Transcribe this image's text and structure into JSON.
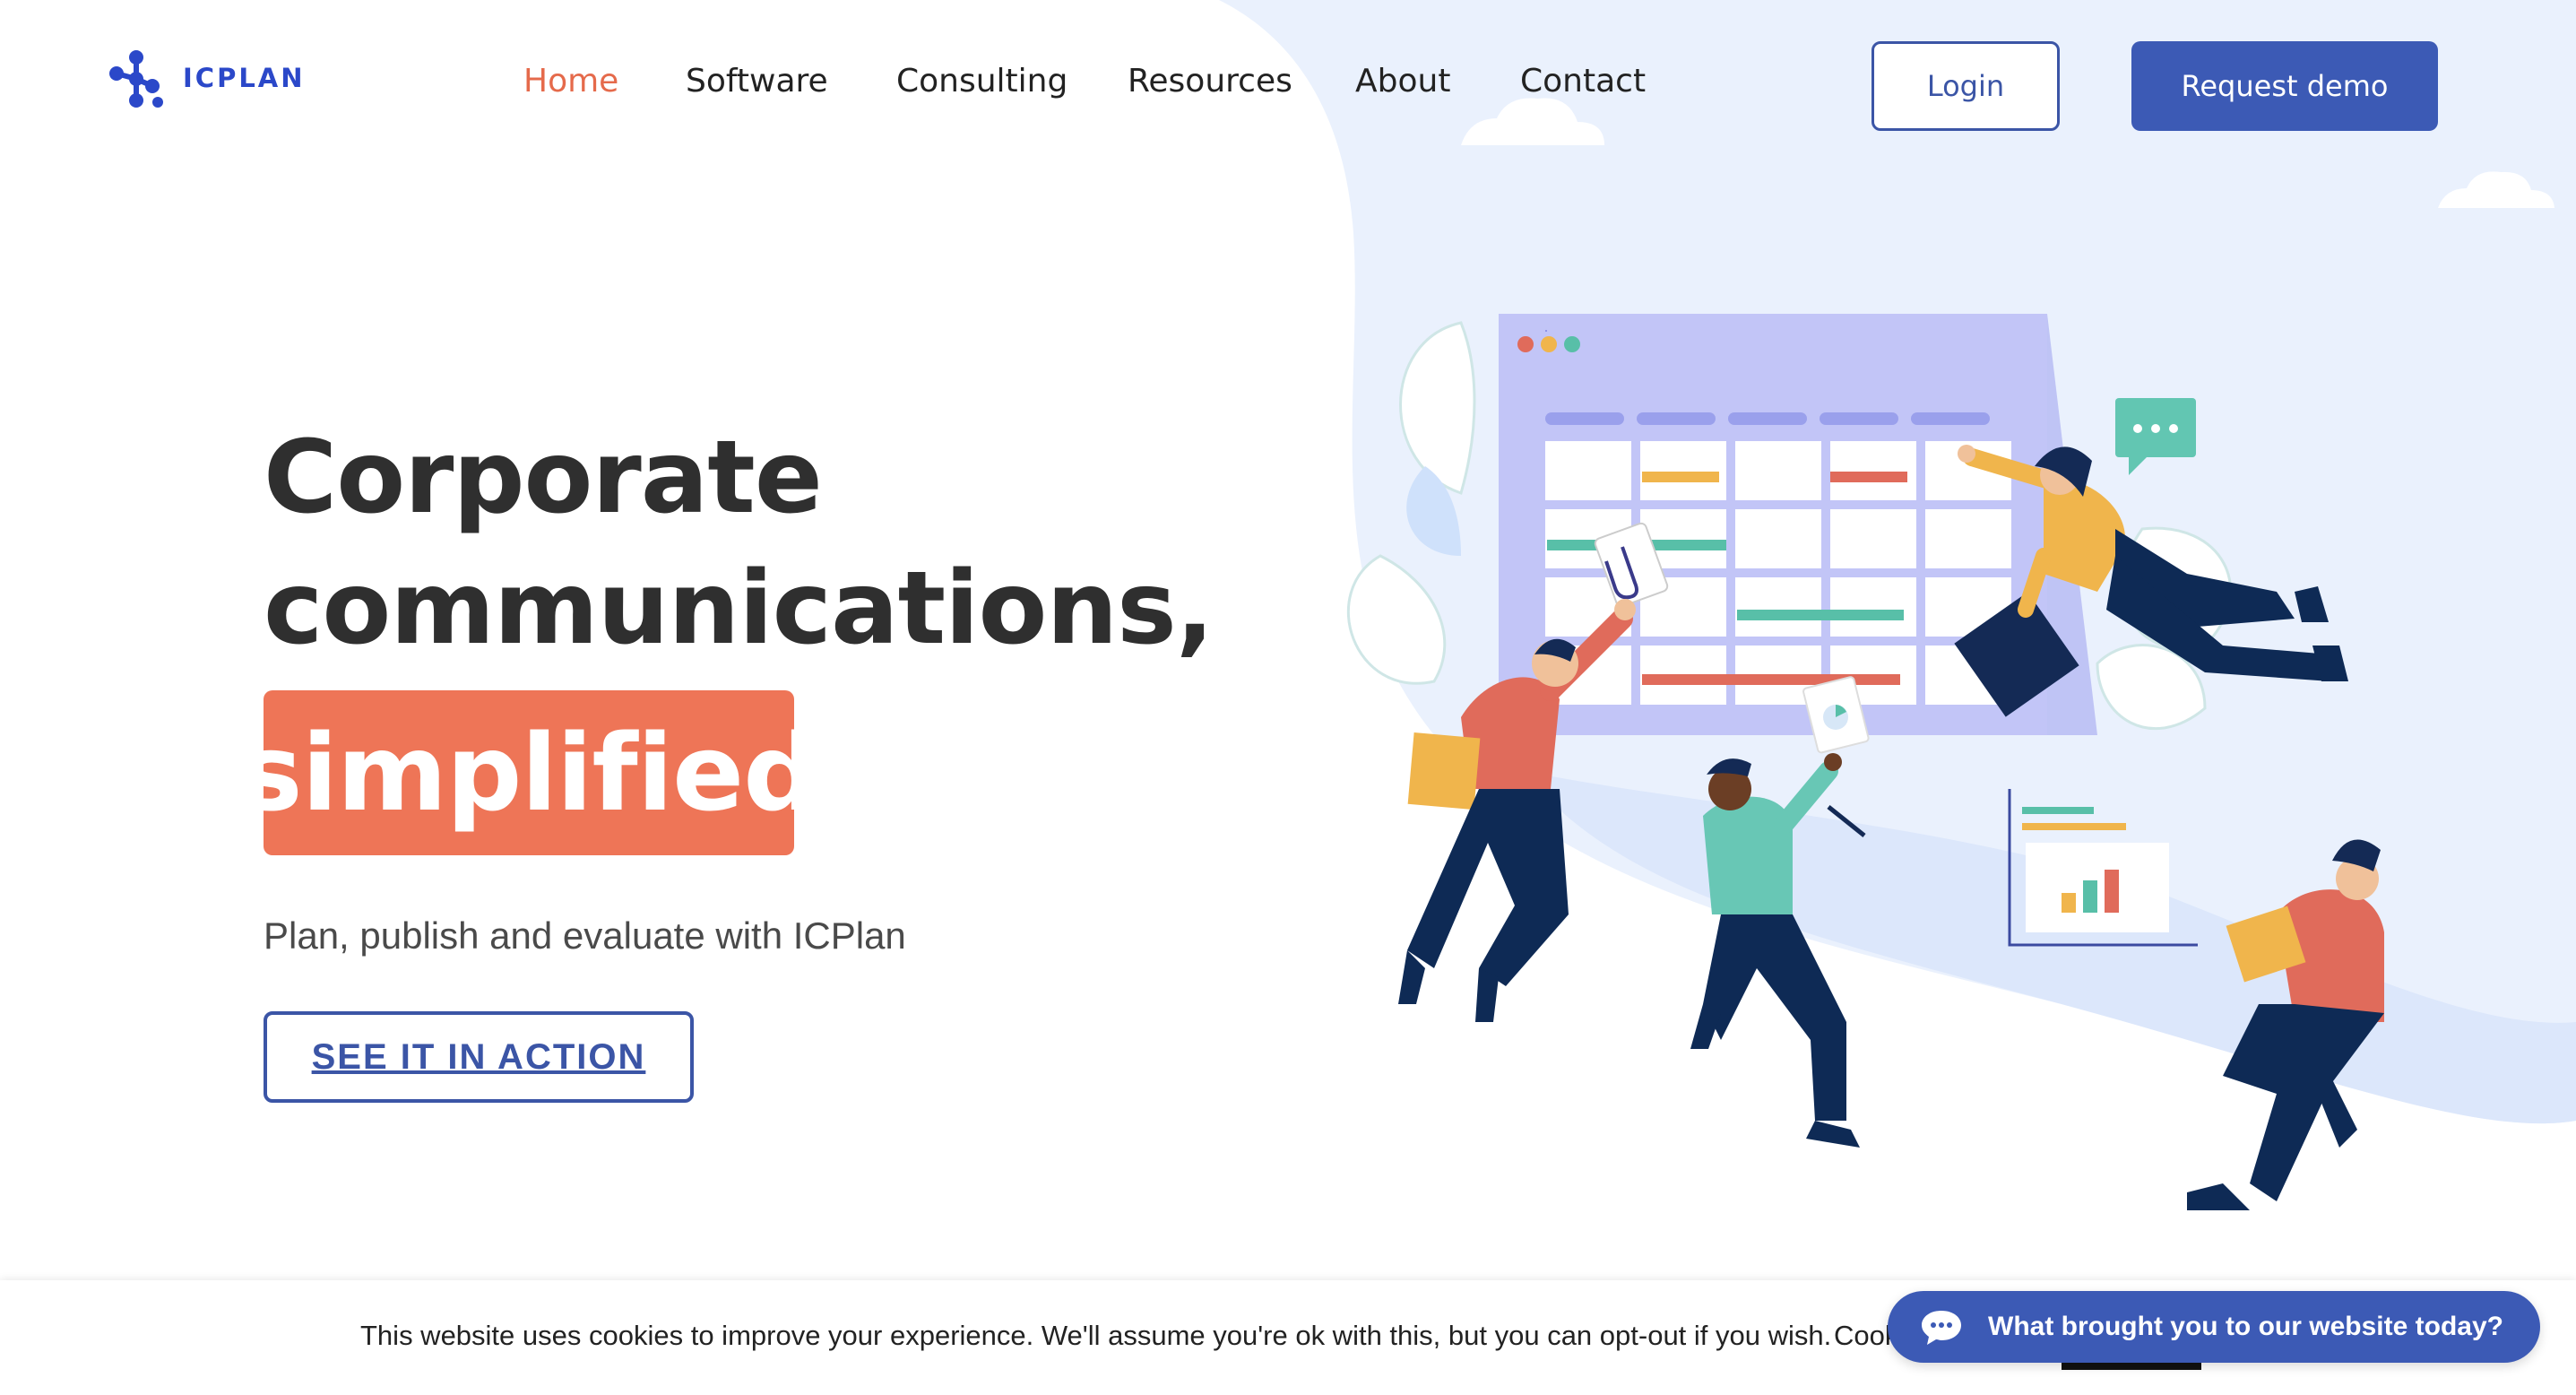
{
  "brand": {
    "name": "ICPLAN",
    "accent": "#2b48c9",
    "primary_button": "#3c5ab5",
    "highlight": "#ee7557"
  },
  "nav": {
    "items": [
      {
        "label": "Home",
        "active": true
      },
      {
        "label": "Software",
        "active": false
      },
      {
        "label": "Consulting",
        "active": false
      },
      {
        "label": "Resources",
        "active": false
      },
      {
        "label": "About",
        "active": false
      },
      {
        "label": "Contact",
        "active": false
      }
    ],
    "login_label": "Login",
    "demo_label": "Request demo"
  },
  "hero": {
    "title_line1": "Corporate",
    "title_line2": "communications,",
    "title_highlight": "simplified",
    "subtitle": "Plan, publish and evaluate with ICPlan",
    "cta_label": "SEE IT IN ACTION"
  },
  "illustration": {
    "icon": "team-planning-calendar-illustration"
  },
  "cookie": {
    "text": "This website uses cookies to improve your experience. We'll assume you're ok with this, but you can opt-out if you wish.",
    "settings_label": "Cook"
  },
  "chat": {
    "icon": "chat-bubble-icon",
    "label": "What brought you to our website today?"
  }
}
